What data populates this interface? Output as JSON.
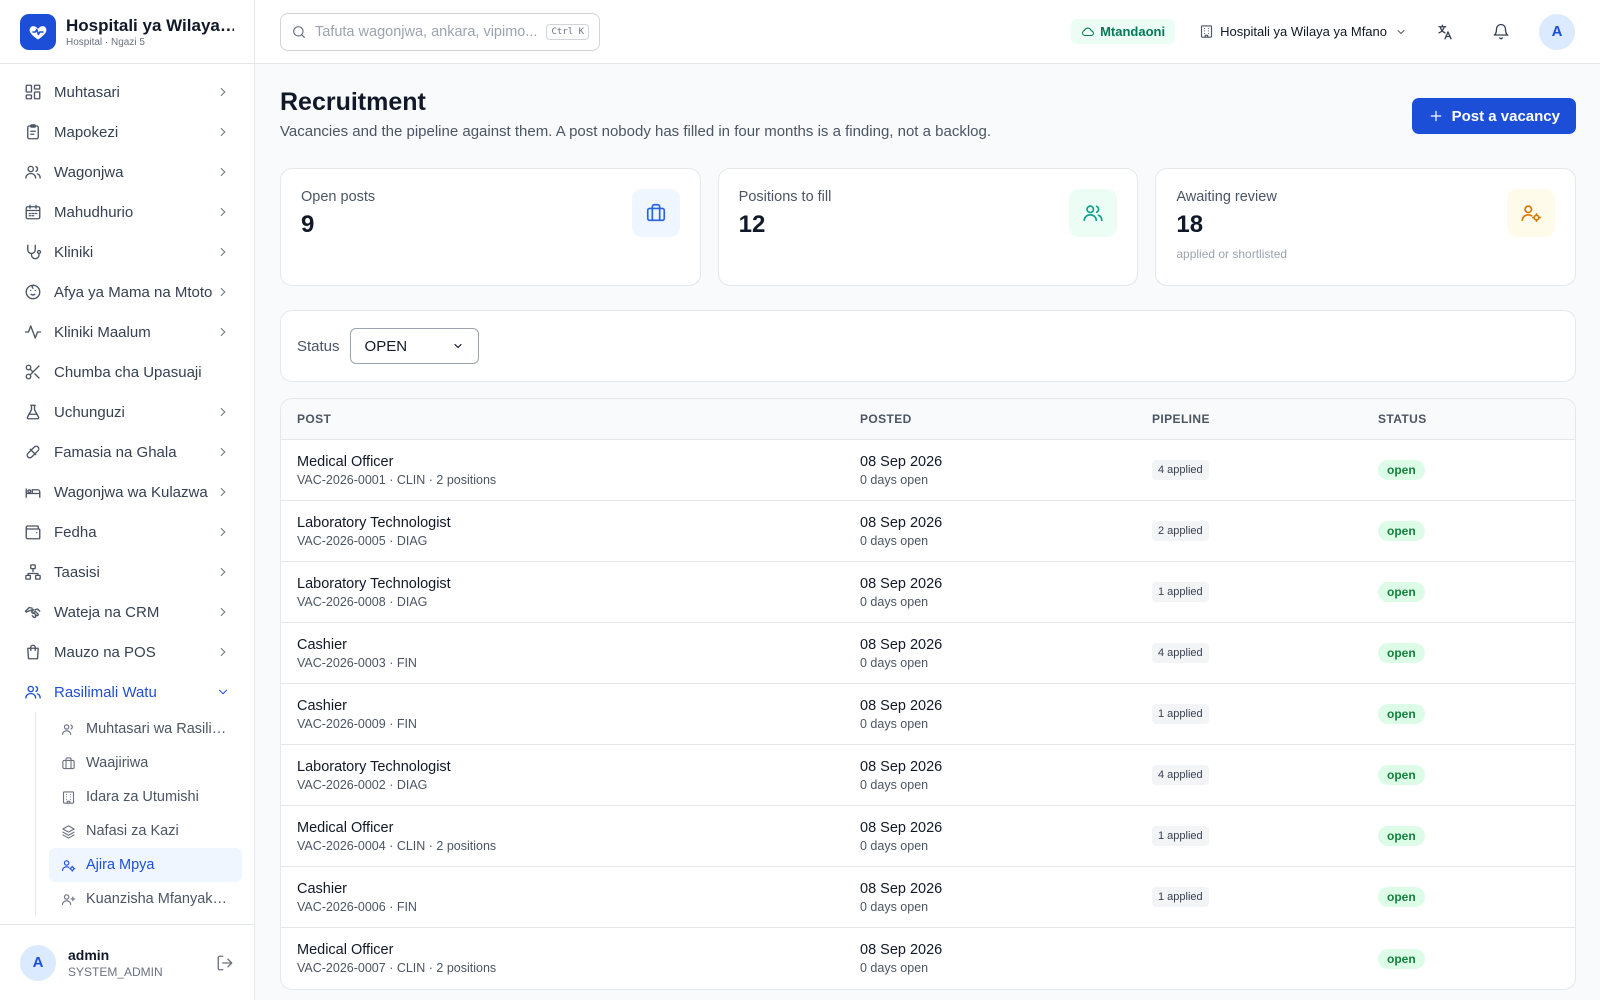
{
  "brand": {
    "name": "Hospitali ya Wilaya ya Mfano",
    "subtitle": "Hospital · Ngazi 5"
  },
  "sidebar": {
    "items": [
      {
        "label": "Muhtasari",
        "icon": "dashboard-icon",
        "chevron": true
      },
      {
        "label": "Mapokezi",
        "icon": "clipboard-icon",
        "chevron": true
      },
      {
        "label": "Wagonjwa",
        "icon": "users-icon",
        "chevron": true
      },
      {
        "label": "Mahudhurio",
        "icon": "calendar-icon",
        "chevron": true
      },
      {
        "label": "Kliniki",
        "icon": "stethoscope-icon",
        "chevron": true
      },
      {
        "label": "Afya ya Mama na Mtoto",
        "icon": "baby-icon",
        "chevron": true
      },
      {
        "label": "Kliniki Maalum",
        "icon": "activity-icon",
        "chevron": true
      },
      {
        "label": "Chumba cha Upasuaji",
        "icon": "scissors-icon",
        "chevron": false
      },
      {
        "label": "Uchunguzi",
        "icon": "flask-icon",
        "chevron": true
      },
      {
        "label": "Famasia na Ghala",
        "icon": "pill-icon",
        "chevron": true
      },
      {
        "label": "Wagonjwa wa Kulazwa",
        "icon": "bed-icon",
        "chevron": true
      },
      {
        "label": "Fedha",
        "icon": "wallet-icon",
        "chevron": true
      },
      {
        "label": "Taasisi",
        "icon": "network-icon",
        "chevron": true
      },
      {
        "label": "Wateja na CRM",
        "icon": "handshake-icon",
        "chevron": true
      },
      {
        "label": "Mauzo na POS",
        "icon": "shopping-bag-icon",
        "chevron": true
      },
      {
        "label": "Rasilimali Watu",
        "icon": "users-icon",
        "chevron": true,
        "expanded": true
      }
    ],
    "subitems": [
      {
        "label": "Muhtasari wa Rasilimali Watu",
        "icon": "users-icon"
      },
      {
        "label": "Waajiriwa",
        "icon": "briefcase-icon"
      },
      {
        "label": "Idara za Utumishi",
        "icon": "building-icon"
      },
      {
        "label": "Nafasi za Kazi",
        "icon": "layers-icon"
      },
      {
        "label": "Ajira Mpya",
        "icon": "user-cog-icon",
        "active": true
      },
      {
        "label": "Kuanzisha Mfanyakazi",
        "icon": "user-plus-icon"
      }
    ]
  },
  "user": {
    "initial": "A",
    "name": "admin",
    "role": "SYSTEM_ADMIN"
  },
  "topbar": {
    "search_placeholder": "Tafuta wagonjwa, ankara, vipimo...",
    "shortcut": "Ctrl K",
    "status": "Mtandaoni",
    "facility": "Hospitali ya Wilaya ya Mfano",
    "avatar_initial": "A"
  },
  "page": {
    "title": "Recruitment",
    "subtitle": "Vacancies and the pipeline against them. A post nobody has filled in four months is a finding, not a backlog.",
    "primary_action": "Post a vacancy"
  },
  "stats": [
    {
      "label": "Open posts",
      "value": "9",
      "hint": "",
      "icon": "briefcase-icon"
    },
    {
      "label": "Positions to fill",
      "value": "12",
      "hint": "",
      "icon": "users-icon"
    },
    {
      "label": "Awaiting review",
      "value": "18",
      "hint": "applied or shortlisted",
      "icon": "user-cog-icon"
    }
  ],
  "filter": {
    "label": "Status",
    "value": "OPEN"
  },
  "table": {
    "columns": [
      "POST",
      "POSTED",
      "PIPELINE",
      "STATUS"
    ],
    "rows": [
      {
        "title": "Medical Officer",
        "meta": "VAC-2026-0001 · CLIN · 2 positions",
        "date": "08 Sep 2026",
        "open": "0 days open",
        "pipeline": "4 applied",
        "status": "open"
      },
      {
        "title": "Laboratory Technologist",
        "meta": "VAC-2026-0005 · DIAG",
        "date": "08 Sep 2026",
        "open": "0 days open",
        "pipeline": "2 applied",
        "status": "open"
      },
      {
        "title": "Laboratory Technologist",
        "meta": "VAC-2026-0008 · DIAG",
        "date": "08 Sep 2026",
        "open": "0 days open",
        "pipeline": "1 applied",
        "status": "open"
      },
      {
        "title": "Cashier",
        "meta": "VAC-2026-0003 · FIN",
        "date": "08 Sep 2026",
        "open": "0 days open",
        "pipeline": "4 applied",
        "status": "open"
      },
      {
        "title": "Cashier",
        "meta": "VAC-2026-0009 · FIN",
        "date": "08 Sep 2026",
        "open": "0 days open",
        "pipeline": "1 applied",
        "status": "open"
      },
      {
        "title": "Laboratory Technologist",
        "meta": "VAC-2026-0002 · DIAG",
        "date": "08 Sep 2026",
        "open": "0 days open",
        "pipeline": "4 applied",
        "status": "open"
      },
      {
        "title": "Medical Officer",
        "meta": "VAC-2026-0004 · CLIN · 2 positions",
        "date": "08 Sep 2026",
        "open": "0 days open",
        "pipeline": "1 applied",
        "status": "open"
      },
      {
        "title": "Cashier",
        "meta": "VAC-2026-0006 · FIN",
        "date": "08 Sep 2026",
        "open": "0 days open",
        "pipeline": "1 applied",
        "status": "open"
      },
      {
        "title": "Medical Officer",
        "meta": "VAC-2026-0007 · CLIN · 2 positions",
        "date": "08 Sep 2026",
        "open": "0 days open",
        "pipeline": "",
        "status": "open"
      }
    ]
  },
  "colors": {
    "accent": "#1d4ed8",
    "status_open_bg": "#dcfce7",
    "status_open_fg": "#15803d",
    "online": "#047857"
  }
}
